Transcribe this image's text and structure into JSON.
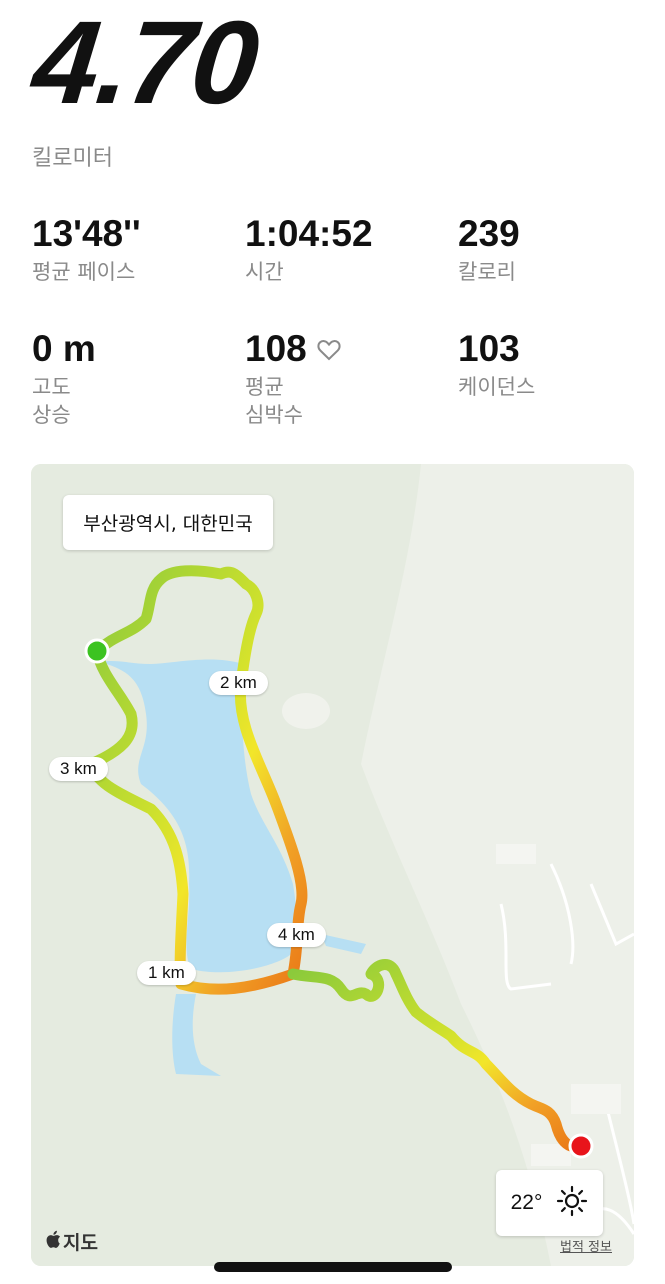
{
  "summary": {
    "distance": "4.70",
    "distance_unit": "킬로미터"
  },
  "stats": {
    "pace": {
      "value": "13'48''",
      "label": "평균 페이스"
    },
    "time": {
      "value": "1:04:52",
      "label": "시간"
    },
    "calories": {
      "value": "239",
      "label": "칼로리"
    },
    "elevation": {
      "value": "0 m",
      "label_line1": "고도",
      "label_line2": "상승"
    },
    "heart_rate": {
      "value": "108",
      "label_line1": "평균",
      "label_line2": "심박수",
      "icon": "heart-outline-icon"
    },
    "cadence": {
      "value": "103",
      "label": "케이던스"
    }
  },
  "map": {
    "location": "부산광역시, 대한민국",
    "km_markers": [
      "2 km",
      "3 km",
      "4 km",
      "1 km"
    ],
    "start_color": "#3cc321",
    "end_color": "#e8141b",
    "weather": {
      "temperature": "22°",
      "icon": "sun-icon"
    },
    "brand": "지도",
    "brand_icon": "apple-logo-icon",
    "legal_link": "법적 정보"
  },
  "colors": {
    "water": "#b7dff3",
    "park": "#e5ebe0",
    "route_gradient": [
      "#88c93c",
      "#d6e32e",
      "#f2e62a",
      "#f1a126",
      "#ea7817"
    ]
  }
}
